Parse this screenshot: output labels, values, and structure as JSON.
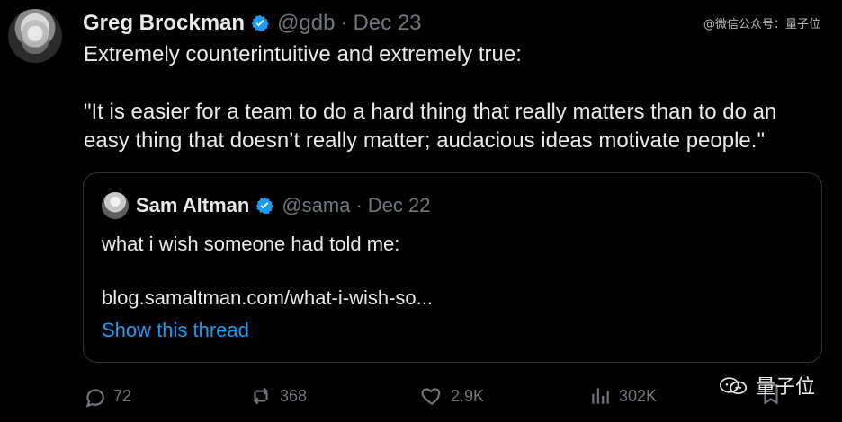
{
  "header": {
    "name": "Greg Brockman",
    "handle": "@gdb",
    "date": "Dec 23",
    "dot": "·"
  },
  "watermark_top": "@微信公众号：量子位",
  "tweet": {
    "line1": "Extremely counterintuitive and extremely true:",
    "line2": "\"It is easier for a team to do a hard thing that really matters than to do an easy thing that doesn’t really matter; audacious ideas motivate people.\""
  },
  "quote": {
    "name": "Sam Altman",
    "handle": "@sama",
    "date": "Dec 22",
    "dot": "·",
    "text": "what i wish someone had told me:",
    "link_text": "blog.samaltman.com/what-i-wish-so...",
    "show_thread": "Show this thread"
  },
  "actions": {
    "reply_count": "72",
    "retweet_count": "368",
    "like_count": "2.9K",
    "views_count": "302K"
  },
  "watermark_bottom": "量子位",
  "colors": {
    "background": "#000000",
    "text": "#e7e9ea",
    "muted": "#71767b",
    "link": "#1d9bf0",
    "verified": "#1d9bf0",
    "border": "#2f3336"
  },
  "icons": {
    "verified": "verified-badge-icon",
    "reply": "reply-icon",
    "retweet": "retweet-icon",
    "like": "heart-icon",
    "views": "analytics-icon",
    "bookmark": "bookmark-icon",
    "wechat": "wechat-icon"
  }
}
